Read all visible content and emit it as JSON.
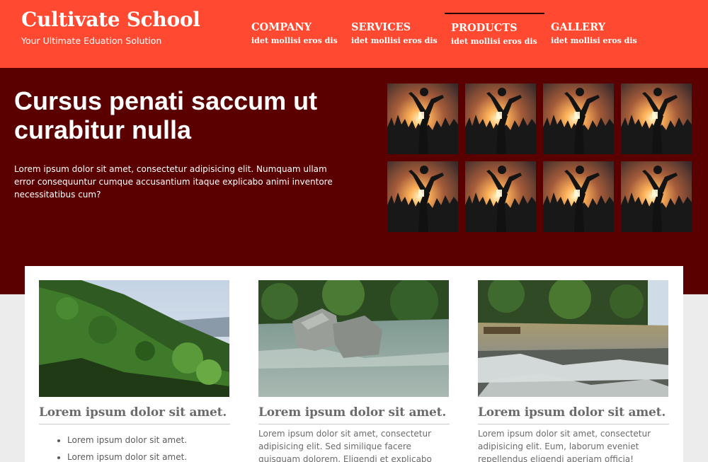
{
  "header": {
    "brand_title": "Cultivate School",
    "brand_tagline": "Your Ultimate Eduation Solution",
    "nav": [
      {
        "label": "COMPANY",
        "sub": "idet mollisi eros dis"
      },
      {
        "label": "SERVICES",
        "sub": "idet mollisi eros dis"
      },
      {
        "label": "PRODUCTS",
        "sub": "idet mollisi eros dis",
        "active": true
      },
      {
        "label": "GALLERY",
        "sub": "idet mollisi eros dis"
      }
    ]
  },
  "hero": {
    "title": "Cursus penati saccum ut curabitur nulla",
    "text": "Lorem ipsum dolor sit amet, consectetur adipisicing elit. Numquam ullam error consequuntur cumque accusantium itaque explicabo animi inventore necessitatibus cum?",
    "thumb_count": 8
  },
  "cards": [
    {
      "title": "Lorem ipsum dolor sit amet.",
      "list": [
        "Lorem ipsum dolor sit amet.",
        "Lorem ipsum dolor sit amet."
      ]
    },
    {
      "title": "Lorem ipsum dolor sit amet.",
      "text": "Lorem ipsum dolor sit amet, consectetur adipisicing elit. Sed similique facere quisquam dolorem. Eligendi et explicabo"
    },
    {
      "title": "Lorem ipsum dolor sit amet.",
      "text": "Lorem ipsum dolor sit amet, consectetur adipisicing elit. Eum, laborum eveniet repellendus eligendi aperiam officia!"
    }
  ],
  "colors": {
    "header_bg": "#ff4931",
    "hero_bg": "#5a0000",
    "page_bg": "#ececec",
    "card_title": "#6b6b6b"
  }
}
